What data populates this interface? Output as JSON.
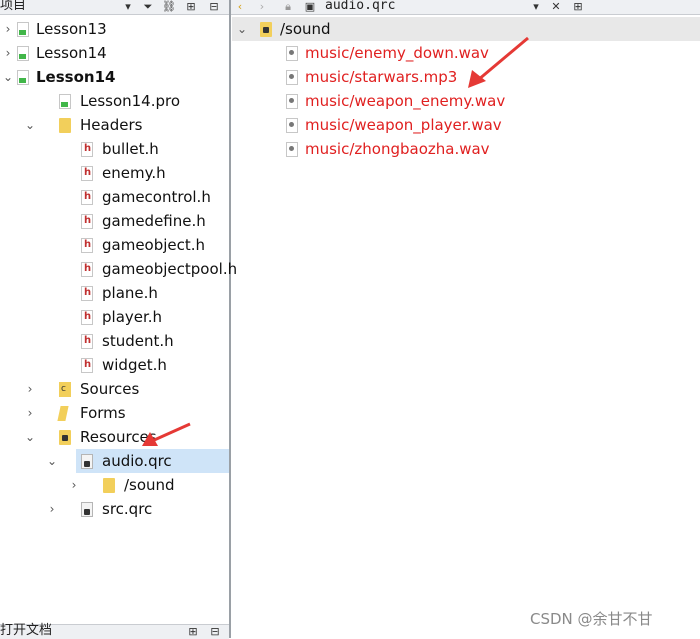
{
  "left_panel": {
    "header_label": "项目",
    "tree": [
      {
        "label": "Lesson13",
        "indent": 0,
        "arrow": "›",
        "icon": "pro"
      },
      {
        "label": "Lesson14",
        "indent": 0,
        "arrow": "›",
        "icon": "pro"
      },
      {
        "label": "Lesson14",
        "indent": 0,
        "arrow": "⌄",
        "icon": "pro",
        "bold": true
      },
      {
        "label": "Lesson14.pro",
        "indent": 1,
        "arrow": "",
        "icon": "pro"
      },
      {
        "label": "Headers",
        "indent": 1,
        "arrow": "⌄",
        "icon": "folder"
      },
      {
        "label": "bullet.h",
        "indent": 2,
        "arrow": "",
        "icon": "h"
      },
      {
        "label": "enemy.h",
        "indent": 2,
        "arrow": "",
        "icon": "h"
      },
      {
        "label": "gamecontrol.h",
        "indent": 2,
        "arrow": "",
        "icon": "h"
      },
      {
        "label": "gamedefine.h",
        "indent": 2,
        "arrow": "",
        "icon": "h"
      },
      {
        "label": "gameobject.h",
        "indent": 2,
        "arrow": "",
        "icon": "h"
      },
      {
        "label": "gameobjectpool.h",
        "indent": 2,
        "arrow": "",
        "icon": "h"
      },
      {
        "label": "plane.h",
        "indent": 2,
        "arrow": "",
        "icon": "h"
      },
      {
        "label": "player.h",
        "indent": 2,
        "arrow": "",
        "icon": "h"
      },
      {
        "label": "student.h",
        "indent": 2,
        "arrow": "",
        "icon": "h"
      },
      {
        "label": "widget.h",
        "indent": 2,
        "arrow": "",
        "icon": "h"
      },
      {
        "label": "Sources",
        "indent": 1,
        "arrow": "›",
        "icon": "sources"
      },
      {
        "label": "Forms",
        "indent": 1,
        "arrow": "›",
        "icon": "forms"
      },
      {
        "label": "Resources",
        "indent": 1,
        "arrow": "⌄",
        "icon": "res"
      },
      {
        "label": "audio.qrc",
        "indent": 2,
        "arrow": "⌄",
        "icon": "qrc",
        "selected": true
      },
      {
        "label": "/sound",
        "indent": 3,
        "arrow": "›",
        "icon": "folder"
      },
      {
        "label": "src.qrc",
        "indent": 2,
        "arrow": "›",
        "icon": "qrc"
      }
    ],
    "bottom_label": "打开文档"
  },
  "right_panel": {
    "tab_title": "audio.qrc",
    "prefix_label": "/sound",
    "files": [
      "music/enemy_down.wav",
      "music/starwars.mp3",
      "music/weapon_enemy.wav",
      "music/weapon_player.wav",
      "music/zhongbaozha.wav"
    ]
  },
  "colors": {
    "file_text": "#e02020",
    "selection": "#cfe4f8",
    "annotation_arrow": "#e53935"
  },
  "watermark": "CSDN @余甘不甘"
}
